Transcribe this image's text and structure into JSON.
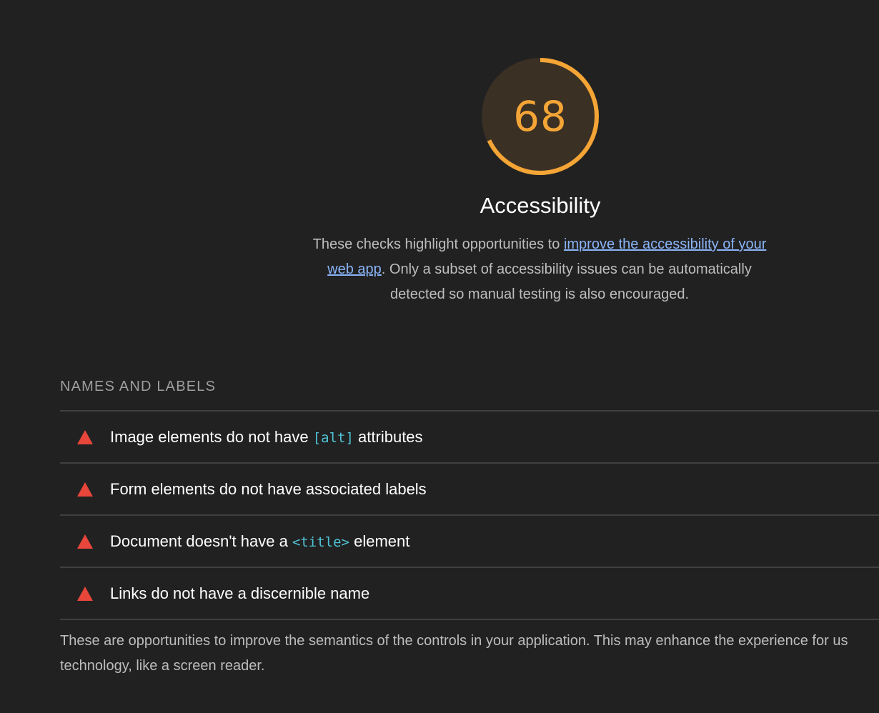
{
  "category": {
    "score": "68",
    "score_fraction": 0.68,
    "title": "Accessibility",
    "description_before": "These checks highlight opportunities to ",
    "description_link": "improve the accessibility of your web app",
    "description_after": ". Only a subset of accessibility issues can be automatically detected so manual testing is also encouraged."
  },
  "group": {
    "title": "NAMES AND LABELS",
    "description_line1": "These are opportunities to improve the semantics of the controls in your application. This may enhance the experience for us",
    "description_line2": "technology, like a screen reader."
  },
  "audits": [
    {
      "before": "Image elements do not have ",
      "code": "[alt]",
      "after": " attributes",
      "status": "fail"
    },
    {
      "before": "Form elements do not have associated labels",
      "code": "",
      "after": "",
      "status": "fail"
    },
    {
      "before": "Document doesn't have a ",
      "code": "<title>",
      "after": " element",
      "status": "fail"
    },
    {
      "before": "Links do not have a discernible name",
      "code": "",
      "after": "",
      "status": "fail"
    }
  ],
  "colors": {
    "background": "#212121",
    "score_average": "#f4a536",
    "gauge_bg": "#3b3024",
    "fail": "#e8463b",
    "link": "#8ab4f8",
    "code": "#4fc3d6"
  },
  "icons": {
    "fail": "warning-triangle-icon"
  }
}
